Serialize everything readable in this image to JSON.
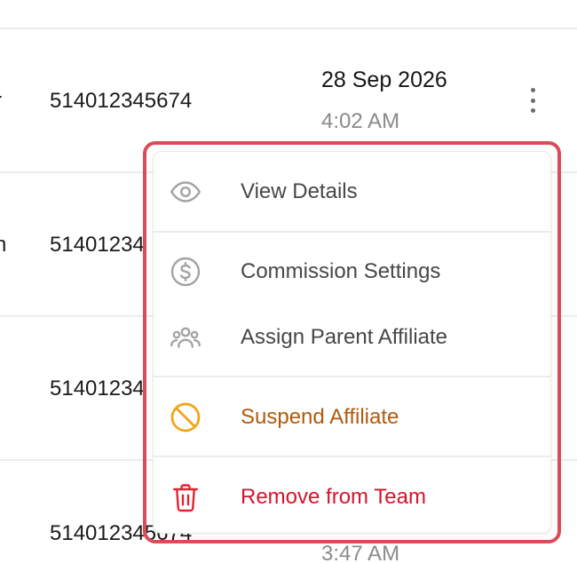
{
  "rows": [
    {
      "prefix": "r",
      "phone": "514012345674",
      "date": "28 Sep 2026",
      "time": "4:02 AM"
    },
    {
      "prefix": "n",
      "phone": "51401234"
    },
    {
      "prefix": "",
      "phone": "51401234"
    },
    {
      "prefix": "",
      "phone": "514012345674",
      "time": "3:47 AM"
    }
  ],
  "menu": {
    "items": [
      {
        "label": "View Details",
        "icon": "eye-icon"
      },
      {
        "label": "Commission Settings",
        "icon": "dollar-circle-icon"
      },
      {
        "label": "Assign Parent Affiliate",
        "icon": "users-group-icon"
      },
      {
        "label": "Suspend Affiliate",
        "icon": "ban-icon",
        "color": "#b05a0e"
      },
      {
        "label": "Remove from Team",
        "icon": "trash-icon",
        "color": "#d4142c"
      }
    ]
  },
  "colors": {
    "highlight": "#dd4a59",
    "warning": "#b05a0e",
    "danger": "#d4142c"
  }
}
